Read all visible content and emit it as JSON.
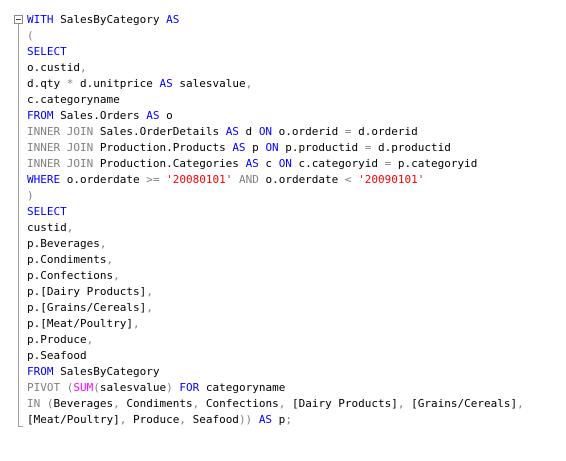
{
  "editor": {
    "language": "T-SQL",
    "colors": {
      "keyword": "#0000ff",
      "operator": "#808080",
      "string": "#ff0000",
      "function": "#ff00ff",
      "text": "#000000"
    },
    "fold_icon": "collapse-minus-icon",
    "lines": [
      [
        {
          "t": "WITH",
          "c": "kw"
        },
        {
          "t": " SalesByCategory "
        },
        {
          "t": "AS",
          "c": "kw"
        }
      ],
      [
        {
          "t": "(",
          "c": "op"
        }
      ],
      [
        {
          "t": "SELECT",
          "c": "kw"
        }
      ],
      [
        {
          "t": "o.custid"
        },
        {
          "t": ",",
          "c": "op"
        }
      ],
      [
        {
          "t": "d.qty "
        },
        {
          "t": "*",
          "c": "op"
        },
        {
          "t": " d.unitprice "
        },
        {
          "t": "AS",
          "c": "kw"
        },
        {
          "t": " salesvalue"
        },
        {
          "t": ",",
          "c": "op"
        }
      ],
      [
        {
          "t": "c.categoryname"
        }
      ],
      [
        {
          "t": "FROM",
          "c": "kw"
        },
        {
          "t": " Sales.Orders "
        },
        {
          "t": "AS",
          "c": "kw"
        },
        {
          "t": " o"
        }
      ],
      [
        {
          "t": "INNER JOIN",
          "c": "op"
        },
        {
          "t": " Sales.OrderDetails "
        },
        {
          "t": "AS",
          "c": "kw"
        },
        {
          "t": " d "
        },
        {
          "t": "ON",
          "c": "kw"
        },
        {
          "t": " o.orderid "
        },
        {
          "t": "=",
          "c": "op"
        },
        {
          "t": " d.orderid"
        }
      ],
      [
        {
          "t": "INNER JOIN",
          "c": "op"
        },
        {
          "t": " Production.Products "
        },
        {
          "t": "AS",
          "c": "kw"
        },
        {
          "t": " p "
        },
        {
          "t": "ON",
          "c": "kw"
        },
        {
          "t": " p.productid "
        },
        {
          "t": "=",
          "c": "op"
        },
        {
          "t": " d.productid"
        }
      ],
      [
        {
          "t": "INNER JOIN",
          "c": "op"
        },
        {
          "t": " Production.Categories "
        },
        {
          "t": "AS",
          "c": "kw"
        },
        {
          "t": " c "
        },
        {
          "t": "ON",
          "c": "kw"
        },
        {
          "t": " c.categoryid "
        },
        {
          "t": "=",
          "c": "op"
        },
        {
          "t": " p.categoryid"
        }
      ],
      [
        {
          "t": "WHERE",
          "c": "kw"
        },
        {
          "t": " o.orderdate "
        },
        {
          "t": ">=",
          "c": "op"
        },
        {
          "t": " "
        },
        {
          "t": "'20080101'",
          "c": "str"
        },
        {
          "t": " "
        },
        {
          "t": "AND",
          "c": "op"
        },
        {
          "t": " o.orderdate "
        },
        {
          "t": "<",
          "c": "op"
        },
        {
          "t": " "
        },
        {
          "t": "'20090101'",
          "c": "str"
        }
      ],
      [
        {
          "t": ")",
          "c": "op"
        }
      ],
      [
        {
          "t": "SELECT",
          "c": "kw"
        }
      ],
      [
        {
          "t": "custid"
        },
        {
          "t": ",",
          "c": "op"
        }
      ],
      [
        {
          "t": "p.Beverages"
        },
        {
          "t": ",",
          "c": "op"
        }
      ],
      [
        {
          "t": "p.Condiments"
        },
        {
          "t": ",",
          "c": "op"
        }
      ],
      [
        {
          "t": "p.Confections"
        },
        {
          "t": ",",
          "c": "op"
        }
      ],
      [
        {
          "t": "p.[Dairy Products]"
        },
        {
          "t": ",",
          "c": "op"
        }
      ],
      [
        {
          "t": "p.[Grains/Cereals]"
        },
        {
          "t": ",",
          "c": "op"
        }
      ],
      [
        {
          "t": "p.[Meat/Poultry]"
        },
        {
          "t": ",",
          "c": "op"
        }
      ],
      [
        {
          "t": "p.Produce"
        },
        {
          "t": ",",
          "c": "op"
        }
      ],
      [
        {
          "t": "p.Seafood"
        }
      ],
      [
        {
          "t": "FROM",
          "c": "kw"
        },
        {
          "t": " SalesByCategory"
        }
      ],
      [
        {
          "t": "PIVOT",
          "c": "op"
        },
        {
          "t": " "
        },
        {
          "t": "(",
          "c": "op"
        },
        {
          "t": "SUM",
          "c": "fn"
        },
        {
          "t": "(",
          "c": "op"
        },
        {
          "t": "salesvalue"
        },
        {
          "t": ")",
          "c": "op"
        },
        {
          "t": " "
        },
        {
          "t": "FOR",
          "c": "kw"
        },
        {
          "t": " categoryname"
        }
      ],
      [
        {
          "t": "IN",
          "c": "op"
        },
        {
          "t": " "
        },
        {
          "t": "(",
          "c": "op"
        },
        {
          "t": "Beverages"
        },
        {
          "t": ",",
          "c": "op"
        },
        {
          "t": " Condiments"
        },
        {
          "t": ",",
          "c": "op"
        },
        {
          "t": " Confections"
        },
        {
          "t": ",",
          "c": "op"
        },
        {
          "t": " [Dairy Products]"
        },
        {
          "t": ",",
          "c": "op"
        },
        {
          "t": " [Grains/Cereals]"
        },
        {
          "t": ",",
          "c": "op"
        }
      ],
      [
        {
          "t": "[Meat/Poultry]"
        },
        {
          "t": ",",
          "c": "op"
        },
        {
          "t": " Produce"
        },
        {
          "t": ",",
          "c": "op"
        },
        {
          "t": " Seafood"
        },
        {
          "t": "))",
          "c": "op"
        },
        {
          "t": " "
        },
        {
          "t": "AS",
          "c": "kw"
        },
        {
          "t": " p"
        },
        {
          "t": ";",
          "c": "op"
        }
      ]
    ]
  }
}
